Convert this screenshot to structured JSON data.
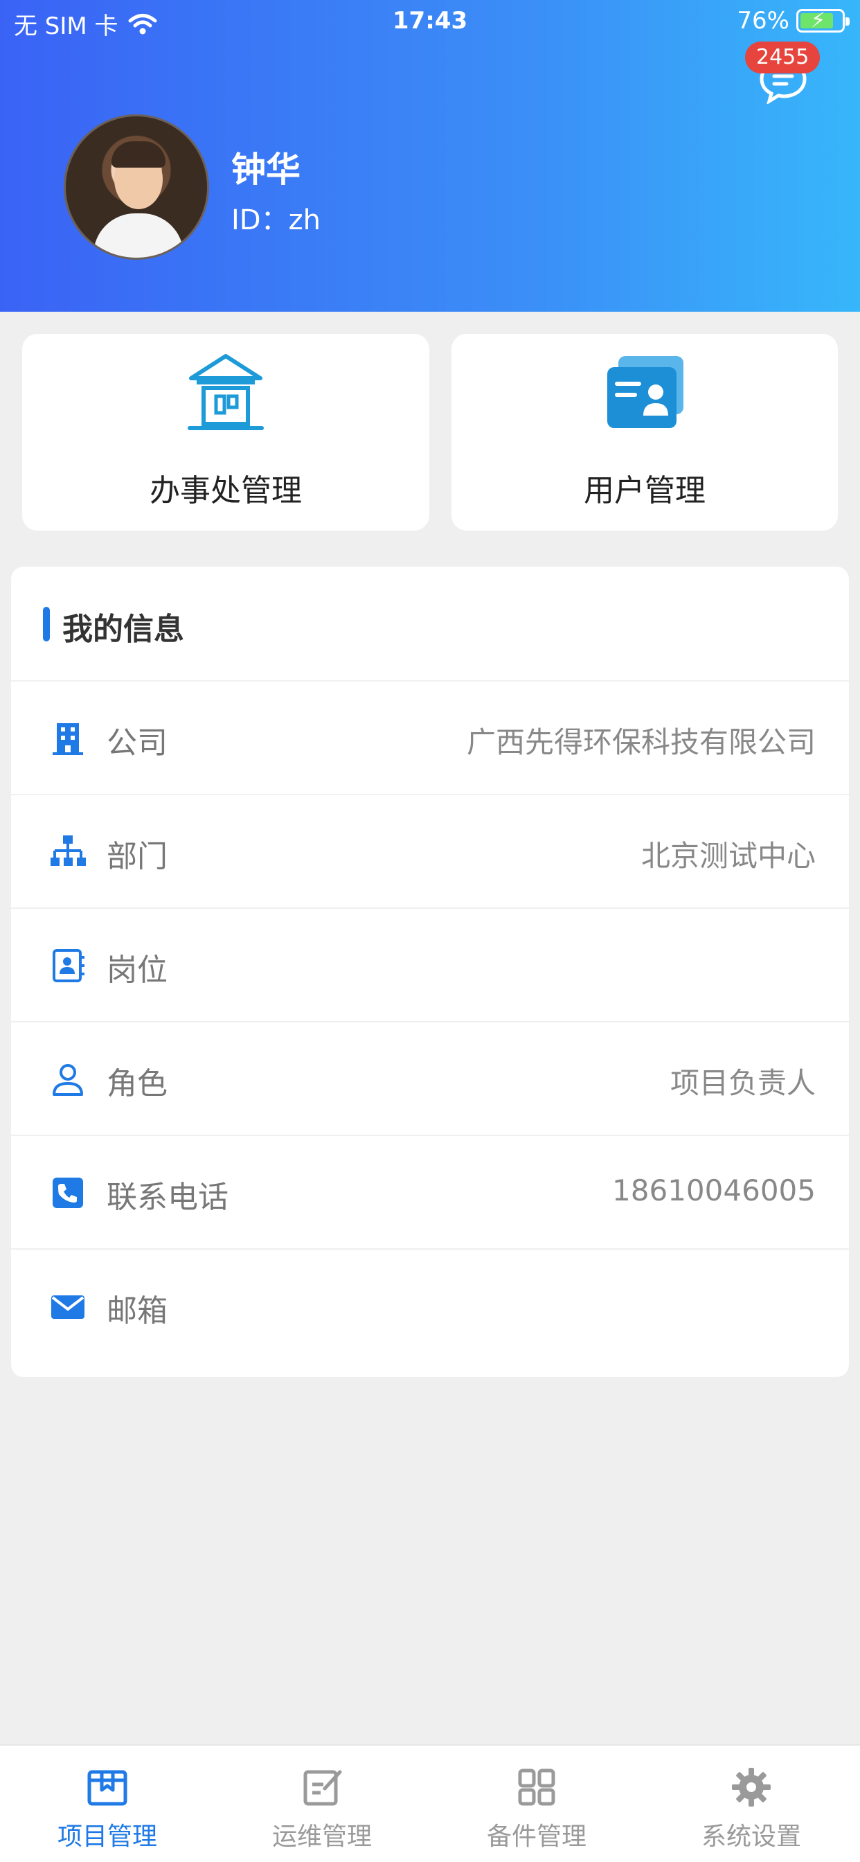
{
  "status_bar": {
    "carrier": "无 SIM 卡",
    "time": "17:43",
    "battery": "76%"
  },
  "header": {
    "badge_count": "2455",
    "user_name": "钟华",
    "user_id": "ID：zh"
  },
  "quick_actions": [
    {
      "label": "办事处管理",
      "icon": "office-building-icon"
    },
    {
      "label": "用户管理",
      "icon": "user-card-icon"
    }
  ],
  "info": {
    "title": "我的信息",
    "rows": [
      {
        "label": "公司",
        "value": "广西先得环保科技有限公司",
        "icon": "company-building-icon"
      },
      {
        "label": "部门",
        "value": "北京测试中心",
        "icon": "org-chart-icon"
      },
      {
        "label": "岗位",
        "value": "",
        "icon": "contact-book-icon"
      },
      {
        "label": "角色",
        "value": "项目负责人",
        "icon": "person-icon"
      },
      {
        "label": "联系电话",
        "value": "18610046005",
        "icon": "phone-icon"
      },
      {
        "label": "邮箱",
        "value": "",
        "icon": "mail-icon"
      }
    ]
  },
  "tabs": [
    {
      "label": "项目管理",
      "icon": "project-icon",
      "active": true
    },
    {
      "label": "运维管理",
      "icon": "edit-icon",
      "active": false
    },
    {
      "label": "备件管理",
      "icon": "grid-icon",
      "active": false
    },
    {
      "label": "系统设置",
      "icon": "gear-icon",
      "active": false
    }
  ],
  "colors": {
    "accent": "#1f7ae6",
    "header_start": "#3a63f5",
    "header_end": "#37b6fa",
    "badge": "#e6443c"
  }
}
